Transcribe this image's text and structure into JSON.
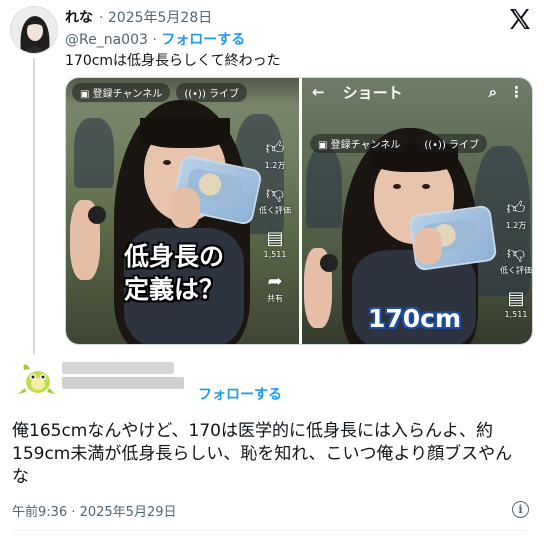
{
  "quoted": {
    "display_name": "れな",
    "date": "· 2025年5月28日",
    "handle": "@Re_na003 ·",
    "follow_label": "フォローする",
    "text": "170cmは低身長らしくて終わった"
  },
  "video_left": {
    "subscribe_label": "登録チャンネル",
    "live_label": "ライブ",
    "overlay_line1": "低身長の",
    "overlay_line2": "定義は？",
    "likes": "1.2万",
    "dislike_label": "低く評価",
    "comments": "1,511",
    "share_label": "共有"
  },
  "video_right": {
    "header_title": "ショート",
    "subscribe_label": "登録チャンネル",
    "live_label": "ライブ",
    "overlay_text": "170cm",
    "likes": "1.2万",
    "dislike_label": "低く評価",
    "comments": "1,511"
  },
  "reply": {
    "follow_label": "フォローする",
    "text": "俺165cmなんやけど、170は医学的に低身長には入らんよ、約159cm未満が低身長らしい、恥を知れ、こいつ俺より顔ブスやんな",
    "timestamp": "午前9:36 · 2025年5月29日",
    "info_glyph": "i"
  },
  "icons": [
    "x-logo-icon",
    "info-icon",
    "thumbs-up-icon",
    "thumbs-down-icon",
    "comment-icon",
    "share-icon",
    "search-icon",
    "more-icon",
    "back-arrow-icon",
    "live-icon"
  ],
  "colors": {
    "accent": "#1d9bf0",
    "text": "#0f1419",
    "muted": "#536471"
  }
}
